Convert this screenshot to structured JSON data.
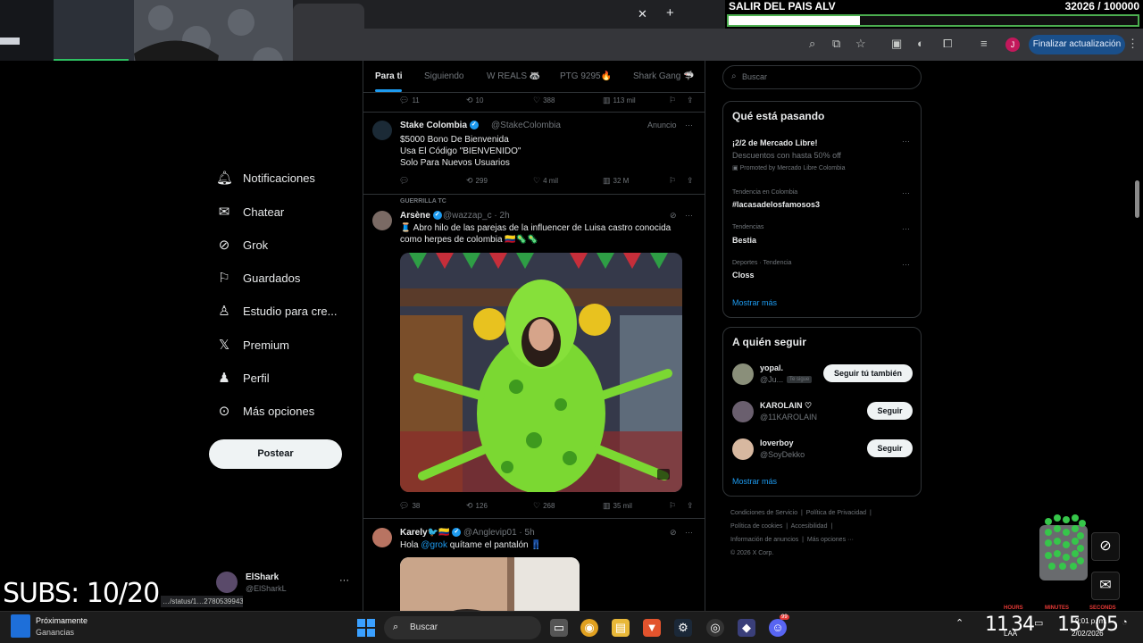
{
  "browser": {
    "update_label": "Finalizar actualización",
    "profile_initial": "J",
    "status_url": "…/status/1…27805399430/photo/1"
  },
  "goal": {
    "label": "SALIR DEL PAIS ALV",
    "count": "32026",
    "target": "/ 100000",
    "progress": 0.32
  },
  "nav": {
    "items": [
      {
        "label": "Notificaciones",
        "icon": "bell-icon"
      },
      {
        "label": "Chatear",
        "icon": "mail-icon"
      },
      {
        "label": "Grok",
        "icon": "grok-icon"
      },
      {
        "label": "Guardados",
        "icon": "bookmark-icon"
      },
      {
        "label": "Estudio para cre...",
        "icon": "studio-icon"
      },
      {
        "label": "Premium",
        "icon": "x-logo-icon"
      },
      {
        "label": "Perfil",
        "icon": "person-icon"
      },
      {
        "label": "Más opciones",
        "icon": "more-circle-icon"
      }
    ],
    "post_label": "Postear",
    "account": {
      "name": "ElShark",
      "handle": "@ElSharkL"
    }
  },
  "feed": {
    "tabs": [
      "Para ti",
      "Siguiendo",
      "W REALS 🦝",
      "PTG 9295🔥",
      "Shark Gang 🦈"
    ],
    "prev_actions": {
      "replies": "11",
      "reposts": "10",
      "likes": "388",
      "views": "113 mil"
    },
    "tweets": [
      {
        "name": "Stake Colombia",
        "handle": "@StakeColombia",
        "badge": "Anuncio",
        "lines": [
          "$5000 Bono De Bienvenida",
          "Usa El Código \"BIENVENIDO\"",
          "Solo Para Nuevos Usuarios"
        ],
        "actions": {
          "replies": "",
          "reposts": "299",
          "likes": "4 mil",
          "views": "32 M"
        }
      },
      {
        "context": "GUERRILLA TC",
        "name": "Arsène",
        "handle": "@wazzap_c · 2h",
        "text": "🧵 Abro hilo de las parejas de la influencer de Luisa castro conocida como herpes de colombia 🇨🇴🦠🦠",
        "actions": {
          "replies": "38",
          "reposts": "126",
          "likes": "268",
          "views": "35 mil"
        }
      },
      {
        "name": "Karely🐦🇨🇴",
        "handle": "@Anglevip01 · 5h",
        "text_prefix": "Hola ",
        "mention": "@grok",
        "text_suffix": " quítame el pantalón 👖"
      }
    ]
  },
  "right": {
    "search_placeholder": "Buscar",
    "trends_title": "Qué está pasando",
    "trends": [
      {
        "meta": "",
        "title": "¡2/2 de Mercado Libre!",
        "sub": "Descuentos con hasta 50% off",
        "promo": "Promoted by Mercado Libre Colombia"
      },
      {
        "meta": "Tendencia en Colombia",
        "title": "#lacasadelosfamosos3"
      },
      {
        "meta": "Tendencias",
        "title": "Bestia"
      },
      {
        "meta": "Deportes · Tendencia",
        "title": "Closs"
      }
    ],
    "show_more": "Mostrar más",
    "who_title": "A quién seguir",
    "who": [
      {
        "name": "yopal.",
        "handle": "@Ju...",
        "badge": "Te sigue",
        "button": "Seguir tú también"
      },
      {
        "name": "KAROLAIN ♡",
        "handle": "@11KAROLAIN",
        "button": "Seguir"
      },
      {
        "name": "loverboy",
        "handle": "@SoyDekko",
        "button": "Seguir"
      }
    ],
    "footer": [
      "Condiciones de Servicio",
      "|",
      "Política de Privacidad",
      "|",
      "Política de cookies",
      "|",
      "Accesibilidad",
      "|",
      "Información de anuncios",
      "|",
      "Más opciones ···",
      "© 2026 X Corp."
    ]
  },
  "overlay": {
    "subs": "SUBS: 10/20",
    "clock_labels": [
      "HOURS",
      "MINUTES",
      "SECONDS"
    ]
  },
  "taskbar": {
    "weather_title": "Próximamente",
    "weather_sub": "Ganancias",
    "search_label": "Buscar",
    "discord_badge": "99",
    "time_big_h": "11",
    "time_big_m": "34",
    "time_big_s": "15",
    "time_big_s2": "05",
    "lang": "LAA",
    "time_small": "9:01 p. m.",
    "date_small": "2/02/2026"
  },
  "colors": {
    "accent": "#1d9bf0",
    "background": "#000000",
    "goal_border": "#4caf50"
  }
}
